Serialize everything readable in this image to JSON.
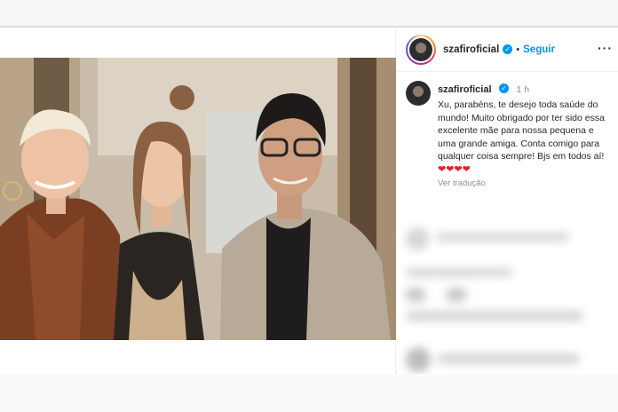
{
  "post": {
    "username": "szafiroficial",
    "follow_label": "Seguir",
    "separator": "•",
    "more_icon": "more-options-icon",
    "caption": {
      "username": "szafiroficial",
      "time": "1 h",
      "text": "Xu, parabéns, te desejo toda saúde do mundo! Muito obrigado por ter sido essa excelente mãe para nossa pequena e uma grande amiga. Conta comigo para qualquer coisa sempre! Bjs em todos aí!",
      "hearts": "❤❤❤❤",
      "translate_label": "Ver tradução"
    },
    "colors": {
      "accent": "#0095f6",
      "heart": "#ed1c24"
    }
  }
}
